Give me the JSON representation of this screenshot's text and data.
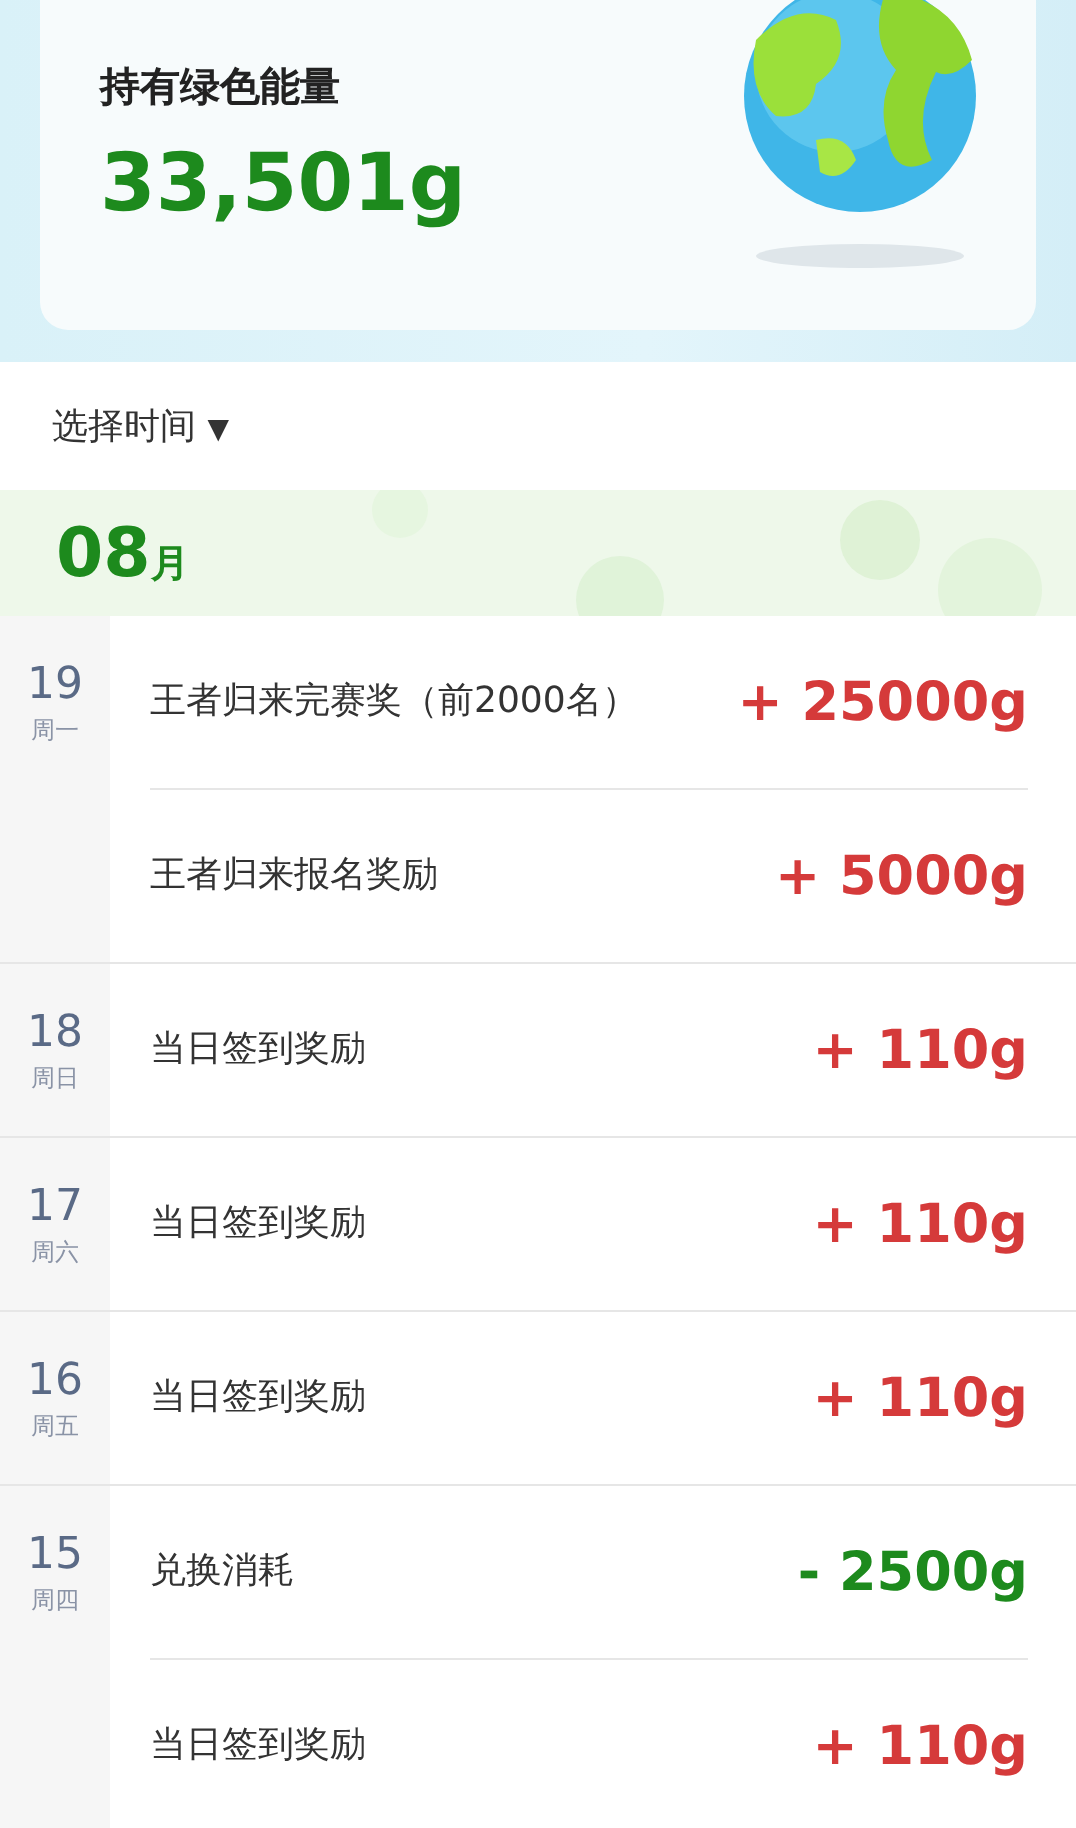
{
  "energy": {
    "label": "持有绿色能量",
    "amount": "33,501g"
  },
  "filter": {
    "label": "选择时间",
    "caret": "▼"
  },
  "month": {
    "number": "08",
    "unit": "月"
  },
  "days": [
    {
      "day": "19",
      "weekday": "周一",
      "entries": [
        {
          "title": "王者归来完赛奖（前2000名）",
          "amount": "+ 25000g",
          "kind": "income"
        },
        {
          "title": "王者归来报名奖励",
          "amount": "+ 5000g",
          "kind": "income"
        }
      ]
    },
    {
      "day": "18",
      "weekday": "周日",
      "entries": [
        {
          "title": "当日签到奖励",
          "amount": "+ 110g",
          "kind": "income"
        }
      ]
    },
    {
      "day": "17",
      "weekday": "周六",
      "entries": [
        {
          "title": "当日签到奖励",
          "amount": "+ 110g",
          "kind": "income"
        }
      ]
    },
    {
      "day": "16",
      "weekday": "周五",
      "entries": [
        {
          "title": "当日签到奖励",
          "amount": "+ 110g",
          "kind": "income"
        }
      ]
    },
    {
      "day": "15",
      "weekday": "周四",
      "entries": [
        {
          "title": "兑换消耗",
          "amount": "- 2500g",
          "kind": "expense"
        },
        {
          "title": "当日签到奖励",
          "amount": "+ 110g",
          "kind": "income"
        }
      ]
    }
  ]
}
